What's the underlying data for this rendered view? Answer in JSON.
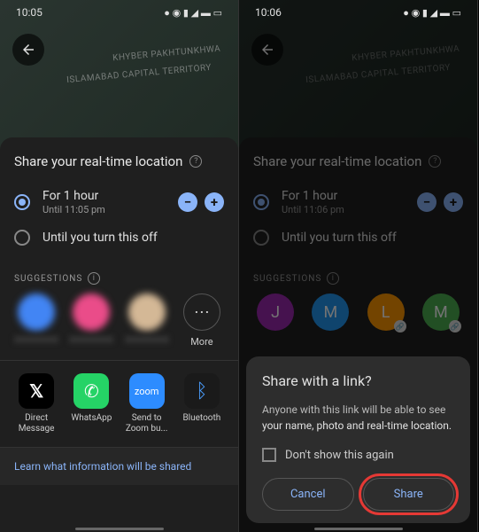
{
  "left": {
    "time": "10:05",
    "map_labels": [
      "KHYBER PAKHTUNKHWA",
      "ISLAMABAD CAPITAL TERRITORY"
    ],
    "sheet_title": "Share your real-time location",
    "opt1_main": "For 1 hour",
    "opt1_sub": "Until 11:05 pm",
    "opt2_main": "Until you turn this off",
    "suggestions_label": "SUGGESTIONS",
    "more_label": "More",
    "apps": [
      {
        "label": "Direct Message"
      },
      {
        "label": "WhatsApp"
      },
      {
        "label": "Send to Zoom bu..."
      },
      {
        "label": "Bluetooth"
      }
    ],
    "footer": "Learn what information will be shared"
  },
  "right": {
    "time": "10:06",
    "map_labels": [
      "KHYBER PAKHTUNKHWA",
      "ISLAMABAD CAPITAL TERRITORY"
    ],
    "sheet_title": "Share your real-time location",
    "opt1_main": "For 1 hour",
    "opt1_sub": "Until 11:06 pm",
    "opt2_main": "Until you turn this off",
    "suggestions_label": "SUGGESTIONS",
    "avatars": [
      "J",
      "M",
      "L",
      "M"
    ],
    "dialog_title": "Share with a link?",
    "dialog_body_pre": "Anyone with this link will be able to see ",
    "dialog_body_strong": "your name, photo and real-time location.",
    "checkbox_label": "Don't show this again",
    "cancel": "Cancel",
    "share": "Share"
  }
}
